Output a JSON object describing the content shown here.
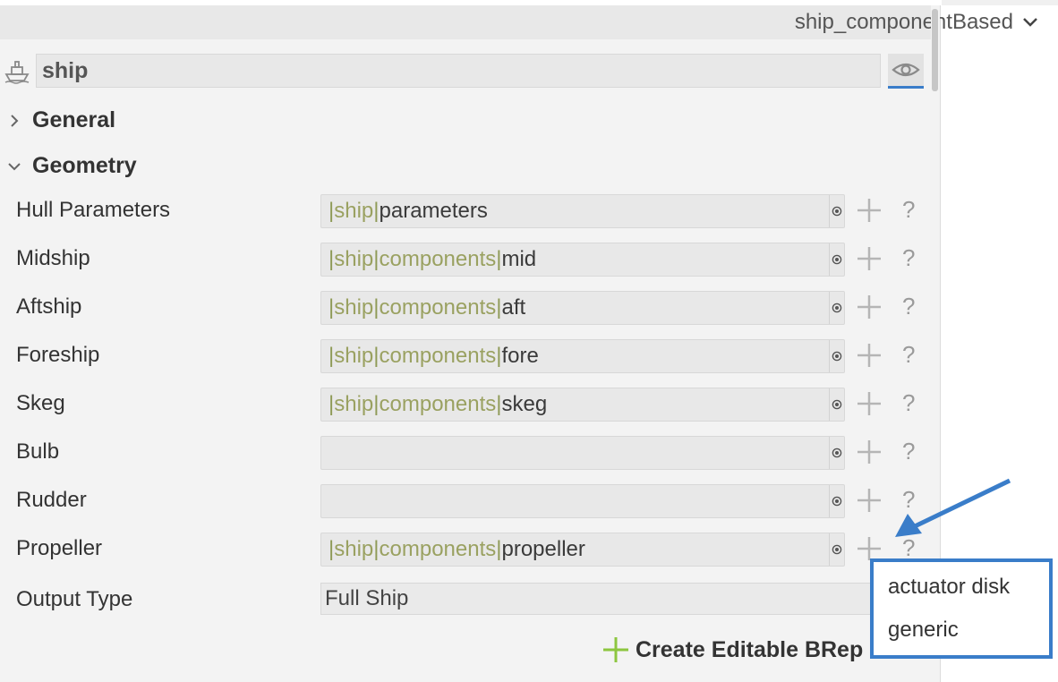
{
  "header": {
    "config_selector": "ship_componentBased"
  },
  "object": {
    "icon": "ship-icon",
    "name": "ship",
    "visibility_icon": "eye-icon"
  },
  "sections": {
    "general": "General",
    "geometry": "Geometry"
  },
  "rows": [
    {
      "label": "Hull Parameters",
      "path": [
        "ship"
      ],
      "last": "parameters"
    },
    {
      "label": "Midship",
      "path": [
        "ship",
        "components"
      ],
      "last": "mid"
    },
    {
      "label": "Aftship",
      "path": [
        "ship",
        "components"
      ],
      "last": "aft"
    },
    {
      "label": "Foreship",
      "path": [
        "ship",
        "components"
      ],
      "last": "fore"
    },
    {
      "label": "Skeg",
      "path": [
        "ship",
        "components"
      ],
      "last": "skeg"
    },
    {
      "label": "Bulb",
      "path": [],
      "last": ""
    },
    {
      "label": "Rudder",
      "path": [],
      "last": ""
    },
    {
      "label": "Propeller",
      "path": [
        "ship",
        "components"
      ],
      "last": "propeller"
    }
  ],
  "row_actions": {
    "add_icon": "plus-icon",
    "help_label": "?"
  },
  "output": {
    "label": "Output Type",
    "value": "Full Ship"
  },
  "create_button": "Create Editable BRep",
  "popup_menu": {
    "items": [
      "actuator disk",
      "generic"
    ]
  },
  "colors": {
    "accent": "#3a7dc9",
    "path_text": "#9aa161",
    "add_green": "#8cc63f"
  }
}
